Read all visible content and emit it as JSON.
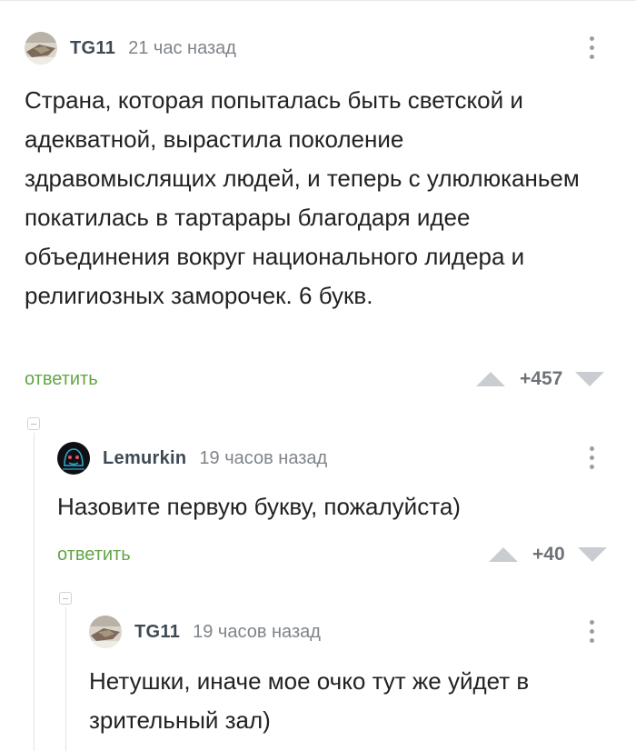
{
  "comments": [
    {
      "author": "TG11",
      "time": "21 час назад",
      "text": "Страна, которая попыталась быть светской и адекватной, вырастила поколение здравомыслящих людей, и теперь с улюлюканьем покатилась в тартарары благодаря идее объединения вокруг национального лидера и религиозных заморочек. 6 букв.",
      "reply_label": "ответить",
      "rating": "+457",
      "avatar_icon": "tg11-avatar-icon"
    },
    {
      "author": "Lemurkin",
      "time": "19 часов назад",
      "text": "Назовите первую букву, пожалуйста)",
      "reply_label": "ответить",
      "rating": "+40",
      "avatar_icon": "lemurkin-avatar-icon"
    },
    {
      "author": "TG11",
      "time": "19 часов назад",
      "text": "Нетушки, иначе мое очко тут же уйдет в зрительный зал)",
      "avatar_icon": "tg11-avatar-icon"
    }
  ],
  "colors": {
    "reply_link": "#63a446",
    "author": "#3d4a55",
    "meta": "#7f8489",
    "vote_arrow": "#c9cdd1"
  }
}
